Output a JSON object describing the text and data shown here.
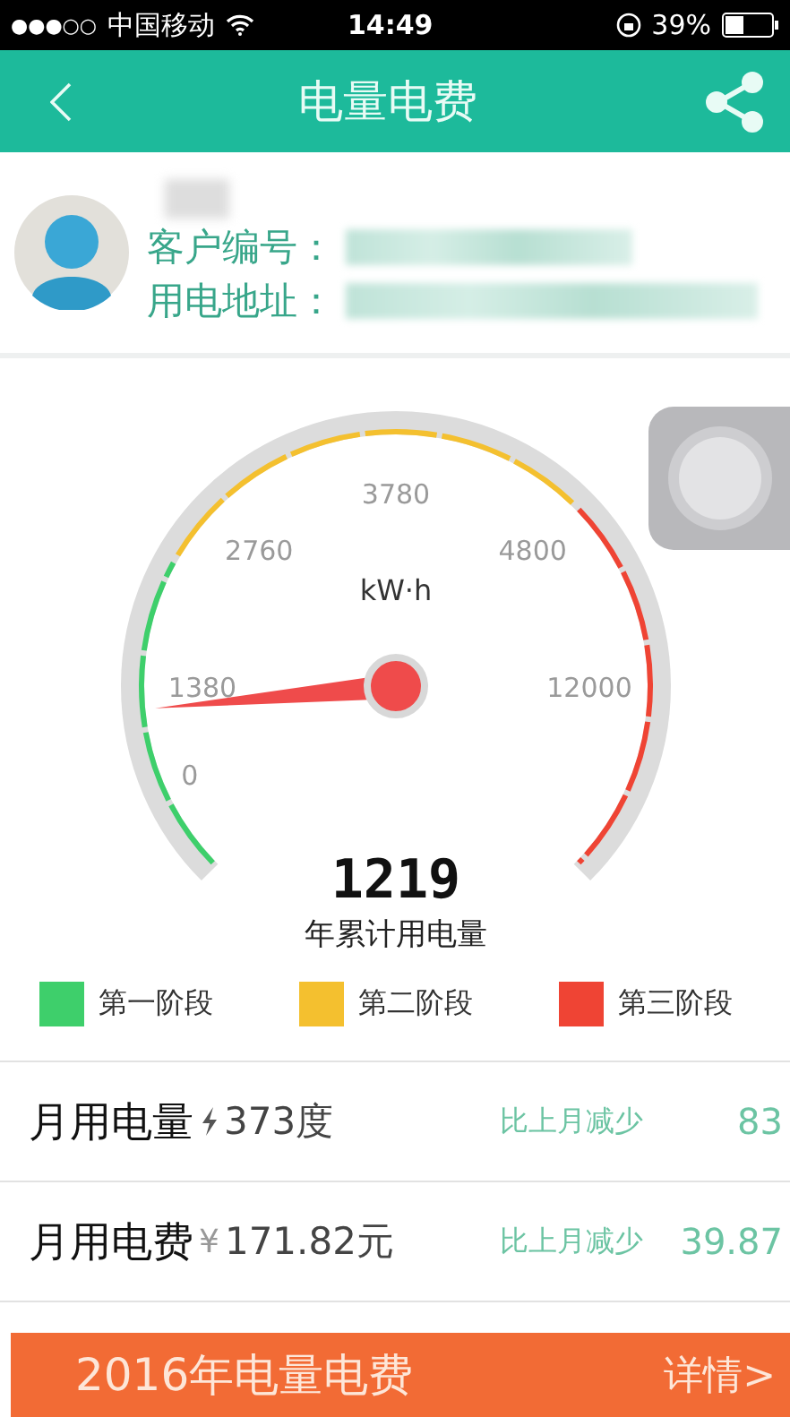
{
  "status_bar": {
    "signal": "●●●○○",
    "carrier": "中国移动",
    "time": "14:49",
    "battery": "39%"
  },
  "header": {
    "title": "电量电费"
  },
  "profile": {
    "fields": [
      {
        "label": "客户编号："
      },
      {
        "label": "用电地址："
      }
    ]
  },
  "gauge": {
    "ticks": [
      "0",
      "1380",
      "2760",
      "3780",
      "4800",
      "12000"
    ],
    "unit": "kW·h",
    "reading": "1219",
    "caption": "年累计用电量"
  },
  "legend": [
    {
      "label": "第一阶段",
      "color": "#3ecf6b"
    },
    {
      "label": "第二阶段",
      "color": "#f4c02f"
    },
    {
      "label": "第三阶段",
      "color": "#ef4434"
    }
  ],
  "summary": [
    {
      "kind": "energy",
      "label": "月用电量",
      "value": "373度",
      "compare": "比上月减少",
      "diff": "83"
    },
    {
      "kind": "cost",
      "label": "月用电费",
      "currency": "¥",
      "value": "171.82元",
      "compare": "比上月减少",
      "diff": "39.87"
    }
  ],
  "footer": {
    "title": "2016年电量电费",
    "link": "详情>"
  }
}
